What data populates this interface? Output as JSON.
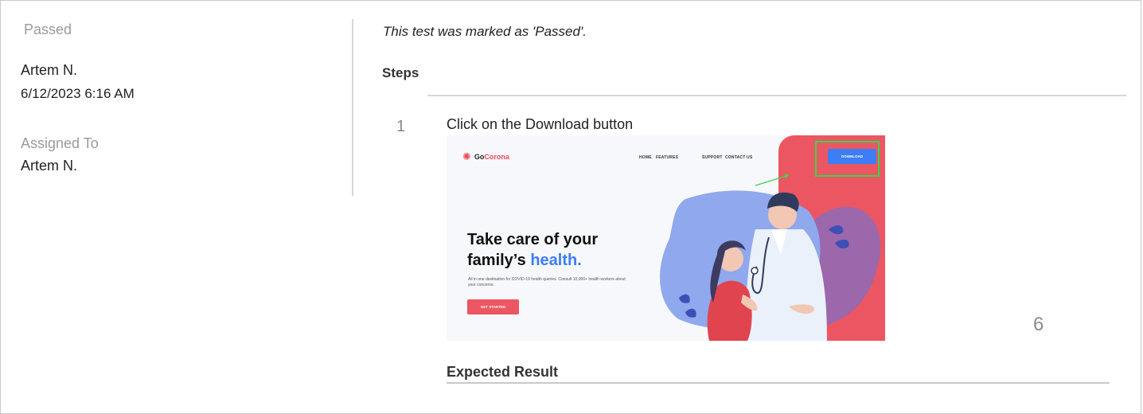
{
  "sidebar": {
    "status_label": "Passed",
    "author": "Artem N.",
    "timestamp": "6/12/2023 6:16 AM",
    "assigned_label": "Assigned To",
    "assigned_value": "Artem N."
  },
  "main": {
    "passed_note": "This test was marked as 'Passed'.",
    "steps_heading": "Steps",
    "steps": [
      {
        "number": "1",
        "text": "Click on the Download button",
        "attachment": {
          "logo_icon": "virus-icon",
          "logo_text": "Go",
          "logo_accent": "Corona",
          "nav": [
            "HOME",
            "FEATURES",
            "SUPPORT",
            "CONTACT US"
          ],
          "download_label": "DOWNLOAD",
          "hero_line1": "Take care of your",
          "hero_line2": "family’s",
          "hero_accent": "health.",
          "hero_sub": "All in one destination for COVID-19 health queries. Consult 10,000+ health workers about your concerns.",
          "cta_label": "GET STARTED",
          "colors": {
            "brand": "#ec5662",
            "accent": "#3d7df5",
            "highlight": "#35d64b"
          }
        }
      }
    ],
    "page_number": "6",
    "expected_heading": "Expected Result"
  }
}
